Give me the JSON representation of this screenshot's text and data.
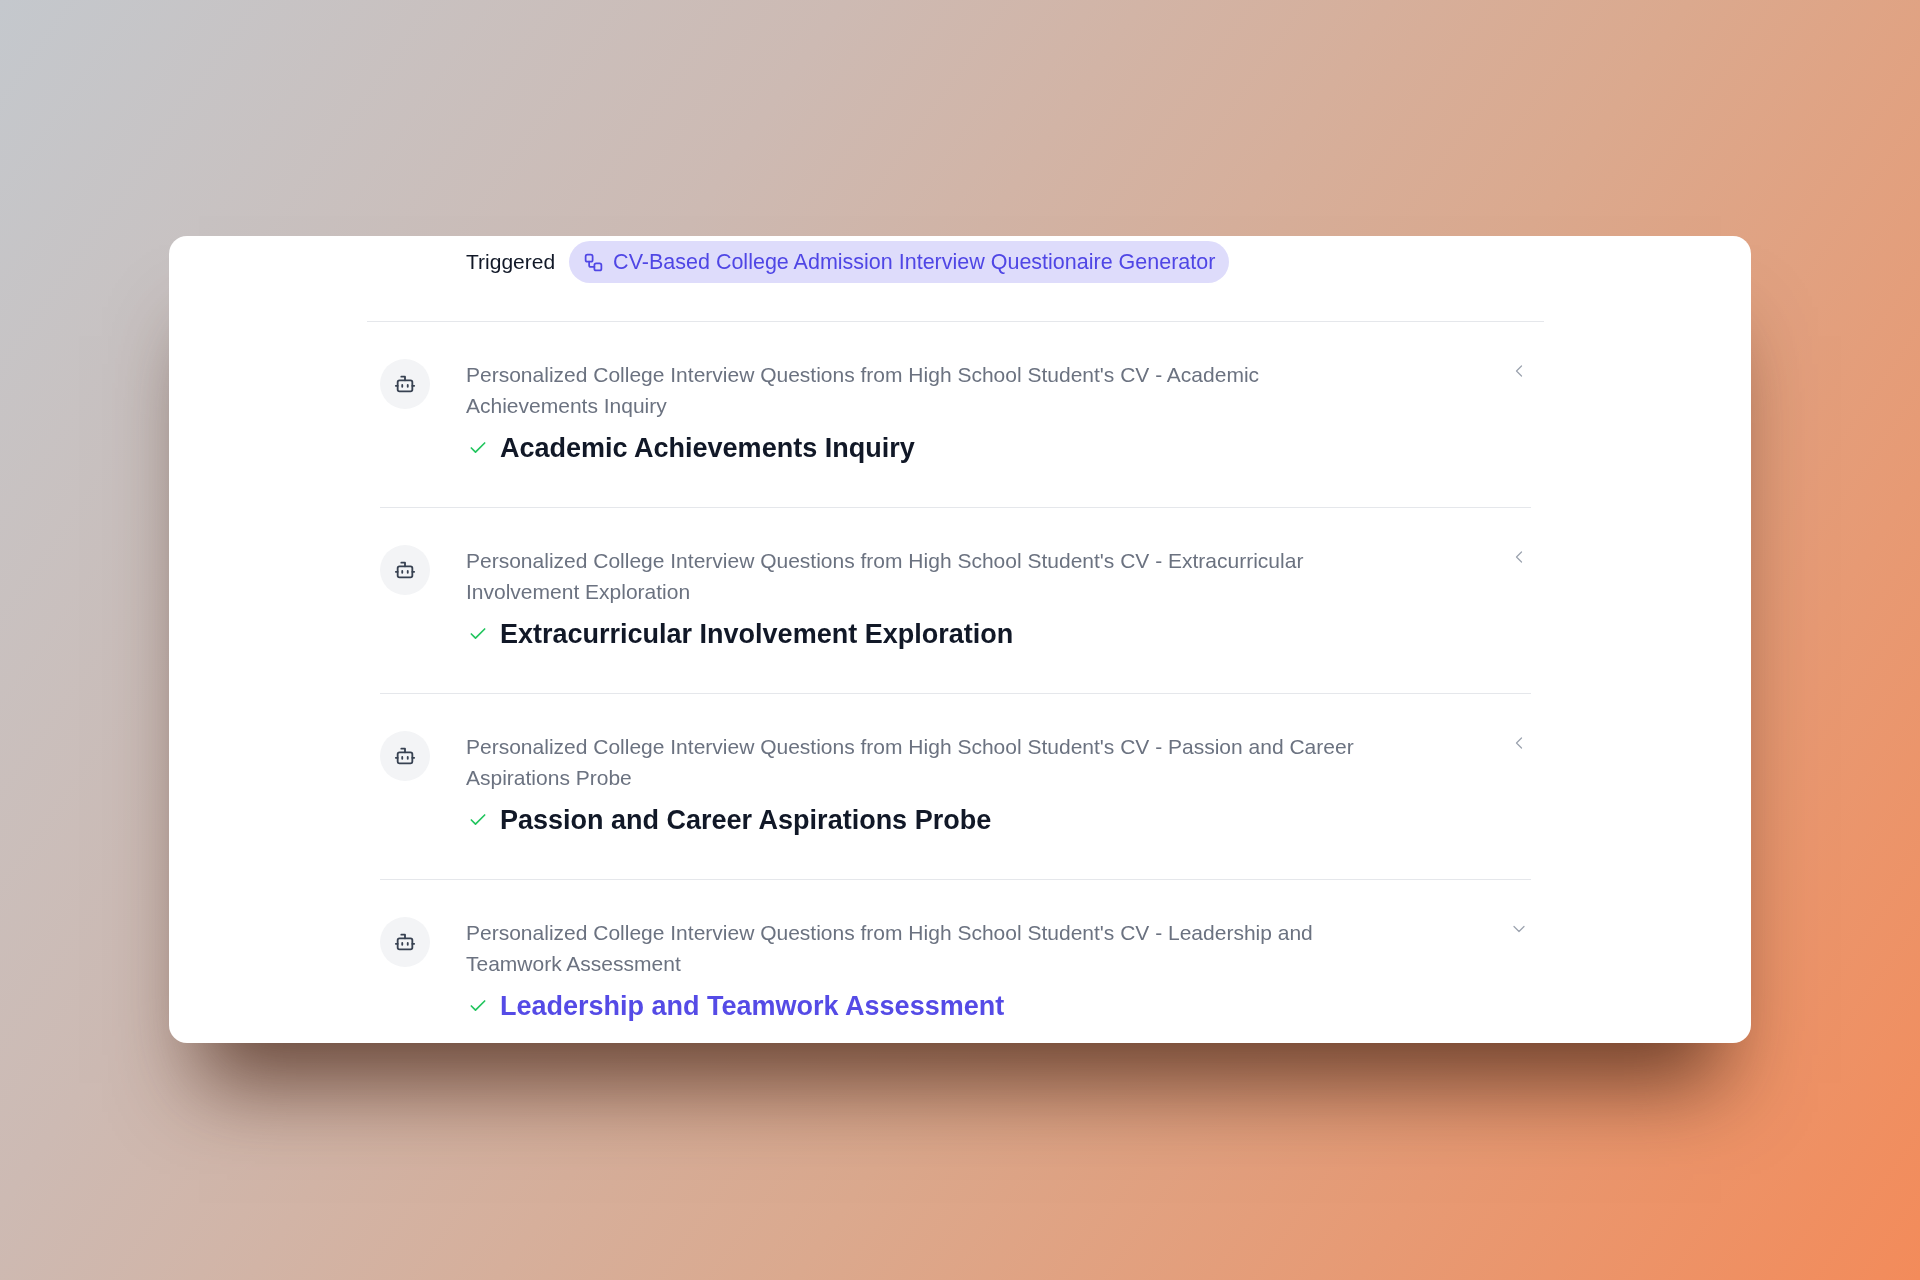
{
  "trigger": {
    "label": "Triggered",
    "workflow": "CV-Based College Admission Interview Questionaire Generator"
  },
  "steps": [
    {
      "subtitle": "Personalized College Interview Questions from High School Student's CV - Academic Achievements Inquiry",
      "title": "Academic Achievements Inquiry",
      "done": true,
      "expanded": false
    },
    {
      "subtitle": "Personalized College Interview Questions from High School Student's CV - Extracurricular Involvement Exploration",
      "title": "Extracurricular Involvement Exploration",
      "done": true,
      "expanded": false
    },
    {
      "subtitle": "Personalized College Interview Questions from High School Student's CV - Passion and Career Aspirations Probe",
      "title": "Passion and Career Aspirations Probe",
      "done": true,
      "expanded": false
    },
    {
      "subtitle": "Personalized College Interview Questions from High School Student's CV - Leadership and Teamwork Assessment",
      "title": "Leadership and Teamwork Assessment",
      "done": true,
      "expanded": true
    }
  ]
}
